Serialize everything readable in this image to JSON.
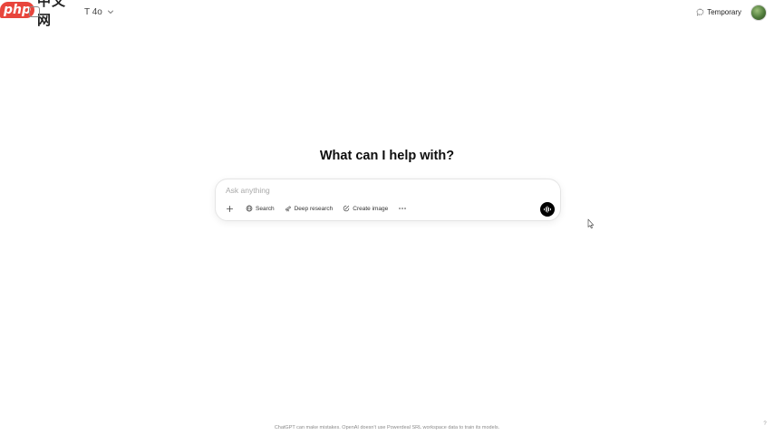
{
  "watermark": {
    "logo_text": "php",
    "site_text": "中文网"
  },
  "header": {
    "model_name": "T 4o",
    "temporary_label": "Temporary"
  },
  "main": {
    "heading": "What can I help with?"
  },
  "composer": {
    "placeholder": "Ask anything",
    "tools": [
      {
        "label": "Search",
        "icon": "globe-icon"
      },
      {
        "label": "Deep research",
        "icon": "telescope-icon"
      },
      {
        "label": "Create image",
        "icon": "image-brush-icon"
      }
    ],
    "more_icon": "ellipsis-icon",
    "add_icon": "plus-icon",
    "voice_icon": "voice-waveform-icon"
  },
  "footer": {
    "disclaimer": "ChatGPT can make mistakes. OpenAI doesn't use Powerdeal SRL workspace data to train its models.",
    "help_label": "?"
  },
  "colors": {
    "background": "#ffffff",
    "text": "#0d0d0d",
    "placeholder": "#a8a8a8",
    "voice_button": "#000000",
    "watermark_red": "#e8453c"
  }
}
